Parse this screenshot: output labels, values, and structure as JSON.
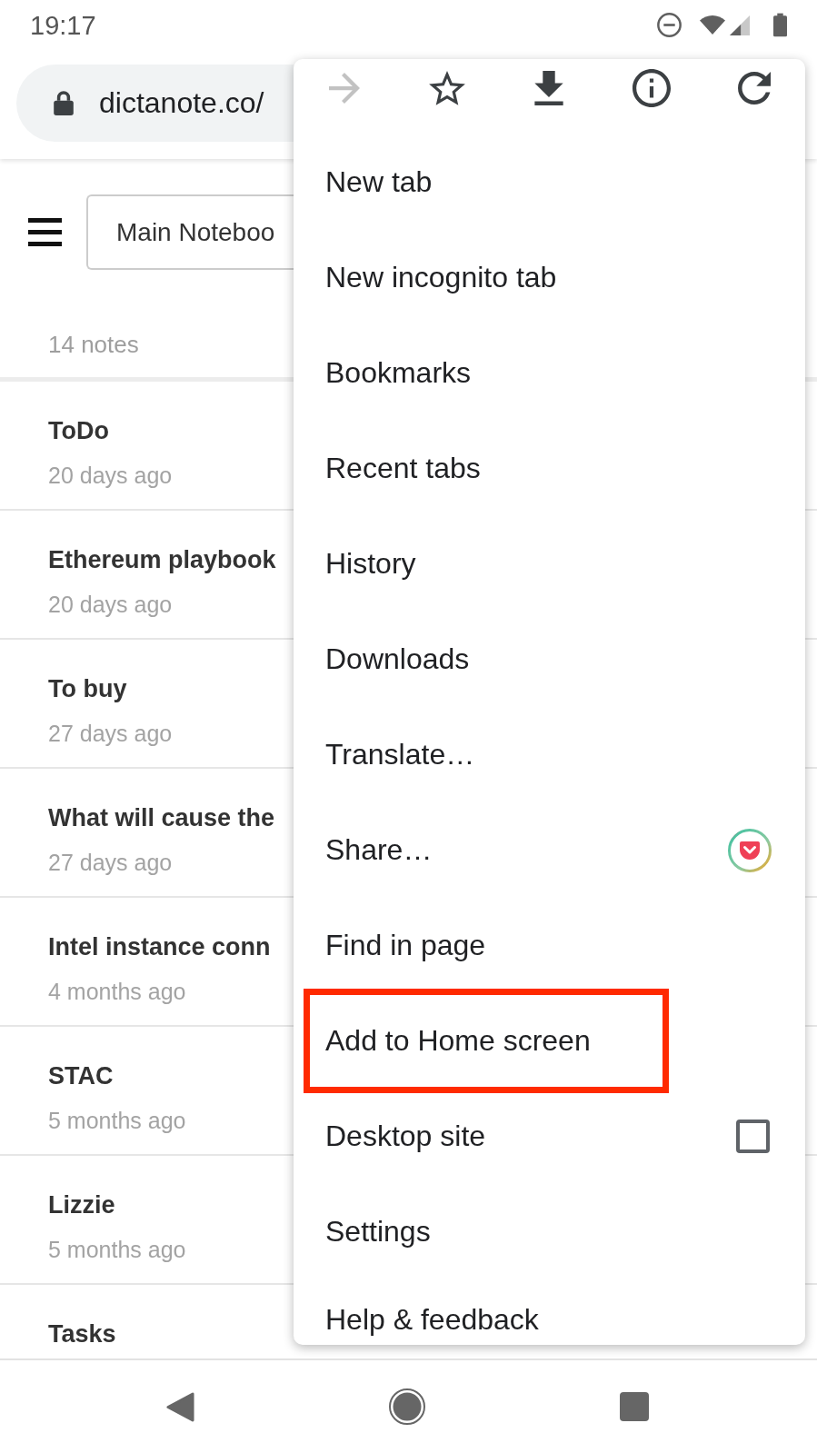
{
  "status_bar": {
    "time": "19:17"
  },
  "address_bar": {
    "url": "dictanote.co/"
  },
  "toolbar": {
    "notebook": "Main Noteboo"
  },
  "notes_count": "14 notes",
  "notes": [
    {
      "title": "ToDo",
      "time": "20 days ago"
    },
    {
      "title": "Ethereum playbook",
      "time": "20 days ago"
    },
    {
      "title": "To buy",
      "time": "27 days ago"
    },
    {
      "title": "What will cause the",
      "time": "27 days ago"
    },
    {
      "title": "Intel instance conn",
      "time": "4 months ago"
    },
    {
      "title": "STAC",
      "time": "5 months ago"
    },
    {
      "title": "Lizzie",
      "time": "5 months ago"
    },
    {
      "title": "Tasks"
    }
  ],
  "menu": {
    "actions": [
      {
        "kind": "forward",
        "disabled": true
      },
      {
        "kind": "bookmark",
        "disabled": false
      },
      {
        "kind": "download",
        "disabled": false
      },
      {
        "kind": "info",
        "disabled": false
      },
      {
        "kind": "refresh",
        "disabled": false
      }
    ],
    "items": [
      {
        "label": "New tab",
        "kind": "text",
        "highlighted": false
      },
      {
        "label": "New incognito tab",
        "kind": "text",
        "highlighted": false
      },
      {
        "label": "Bookmarks",
        "kind": "text",
        "highlighted": false
      },
      {
        "label": "Recent tabs",
        "kind": "text",
        "highlighted": false
      },
      {
        "label": "History",
        "kind": "text",
        "highlighted": false
      },
      {
        "label": "Downloads",
        "kind": "text",
        "highlighted": false
      },
      {
        "label": "Translate…",
        "kind": "text",
        "highlighted": false
      },
      {
        "label": "Share…",
        "kind": "app-shortcut",
        "highlighted": false
      },
      {
        "label": "Find in page",
        "kind": "text",
        "highlighted": false
      },
      {
        "label": "Add to Home screen",
        "kind": "text",
        "highlighted": true
      },
      {
        "label": "Desktop site",
        "kind": "checkbox",
        "checked": false,
        "highlighted": false
      },
      {
        "label": "Settings",
        "kind": "text",
        "highlighted": false
      },
      {
        "label": "Help & feedback",
        "kind": "text",
        "highlighted": false
      }
    ]
  }
}
